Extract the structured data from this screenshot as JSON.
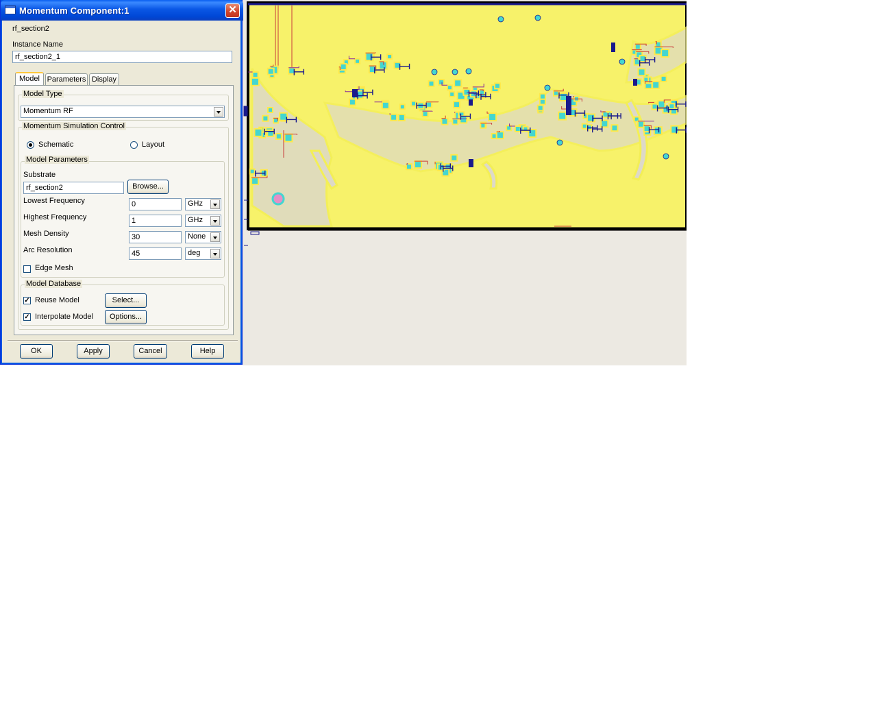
{
  "dialog": {
    "title": "Momentum Component:1",
    "close_glyph": "✕",
    "cell_name": "rf_section2",
    "instance_name_label": "Instance Name",
    "instance_name_value": "rf_section2_1",
    "tabs": [
      {
        "label": "Model",
        "active": true
      },
      {
        "label": "Parameters",
        "active": false
      },
      {
        "label": "Display",
        "active": false
      }
    ],
    "model_type": {
      "group_title": "Model Type",
      "selected": "Momentum RF"
    },
    "simulation_control": {
      "group_title": "Momentum Simulation Control",
      "schematic_label": "Schematic",
      "schematic_checked": true,
      "layout_label": "Layout",
      "layout_checked": false
    },
    "model_parameters": {
      "group_title": "Model Parameters",
      "substrate_label": "Substrate",
      "substrate_value": "rf_section2",
      "browse_label": "Browse...",
      "lowest_freq_label": "Lowest Frequency",
      "lowest_freq_value": "0",
      "lowest_freq_unit": "GHz",
      "highest_freq_label": "Highest Frequency",
      "highest_freq_value": "1",
      "highest_freq_unit": "GHz",
      "mesh_density_label": "Mesh Density",
      "mesh_density_value": "30",
      "mesh_density_unit": "None",
      "arc_resolution_label": "Arc Resolution",
      "arc_resolution_value": "45",
      "arc_resolution_unit": "deg",
      "edge_mesh_label": "Edge Mesh",
      "edge_mesh_checked": false
    },
    "model_database": {
      "group_title": "Model Database",
      "reuse_label": "Reuse Model",
      "reuse_checked": true,
      "select_label": "Select...",
      "interpolate_label": "Interpolate Model",
      "interpolate_checked": true,
      "options_label": "Options..."
    },
    "buttons": {
      "ok": "OK",
      "apply": "Apply",
      "cancel": "Cancel",
      "help": "Help"
    },
    "check_glyph": "✓"
  },
  "layout_view": {
    "board_color": "#f7f26a",
    "border_color": "#000000",
    "pad_color": "#44d6d0",
    "trace_color": "#c83a3a",
    "component_color": "#1a1a8c",
    "ground_color": "#ddd9c8",
    "background_color": "#ece9e2"
  }
}
